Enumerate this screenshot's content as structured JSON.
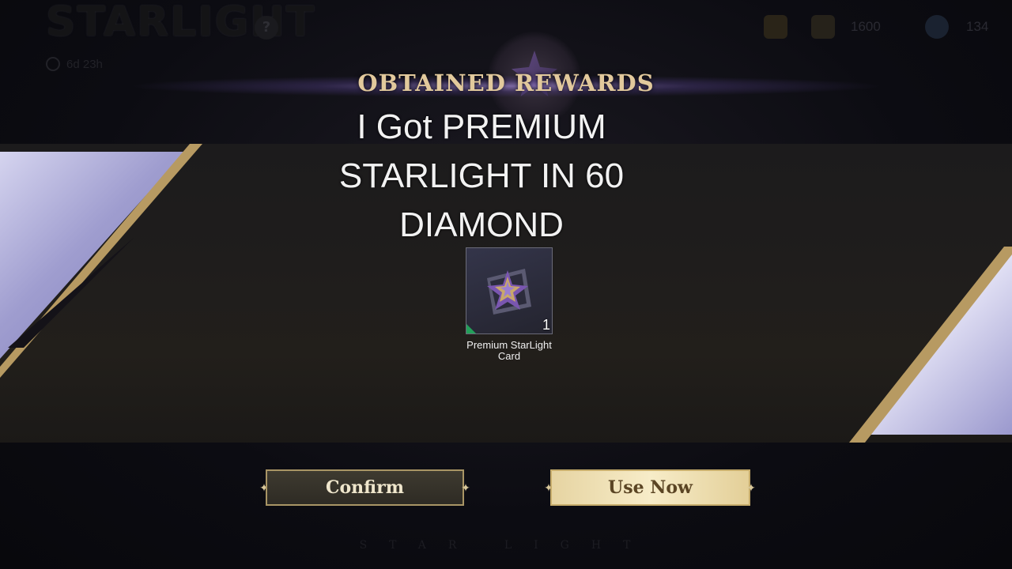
{
  "topbar": {
    "game_logo": "STARLIGHT",
    "help_icon": "question-icon",
    "timer": "6d 23h",
    "currencies": [
      {
        "icon": "chest-icon",
        "value": ""
      },
      {
        "icon": "ticket-icon",
        "value": "1600"
      },
      {
        "icon": "diamond-icon",
        "value": "134"
      }
    ]
  },
  "header": {
    "title": "OBTAINED REWARDS"
  },
  "overlay_caption": "I Got  PREMIUM STARLIGHT IN 60 DIAMOND",
  "reward": {
    "name": "Premium StarLight Card",
    "quantity": "1"
  },
  "buttons": {
    "confirm": "Confirm",
    "use_now": "Use Now"
  },
  "footer": {
    "mark": "STAR LIGHT"
  },
  "colors": {
    "gold_text": "#e2c99c",
    "button_gold": "#f7ecc8",
    "rarity_green": "#23a05a"
  }
}
